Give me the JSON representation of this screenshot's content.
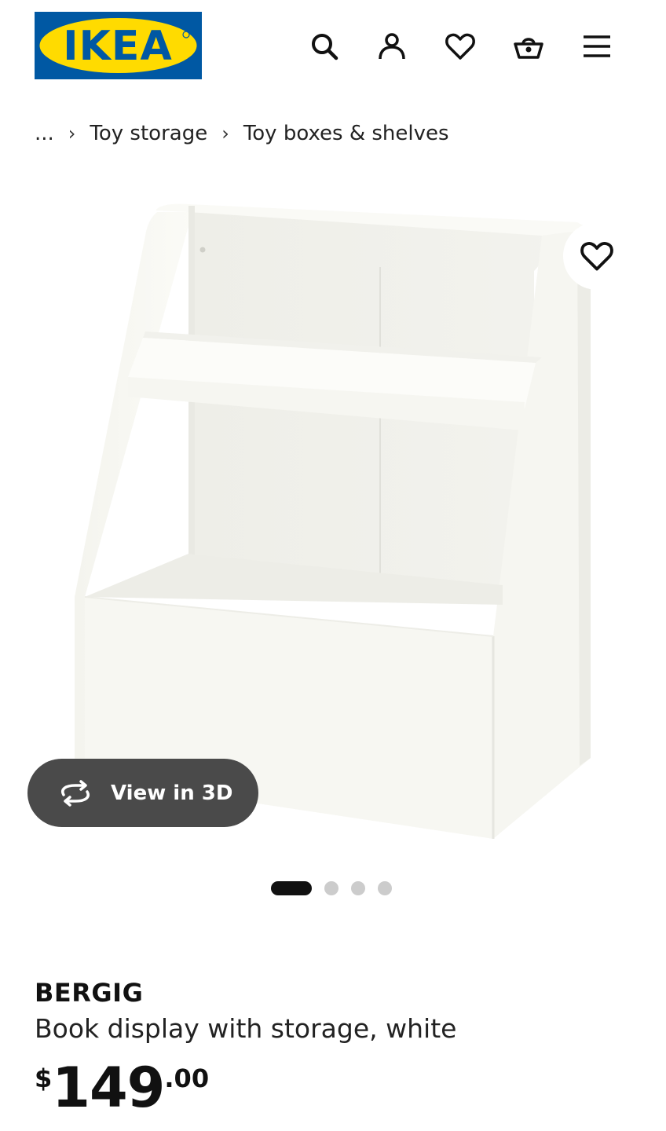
{
  "header": {
    "logo_text": "IKEA",
    "icons": [
      "search-icon",
      "account-icon",
      "favourites-icon",
      "basket-icon",
      "menu-icon"
    ]
  },
  "breadcrumb": {
    "ellipsis": "...",
    "separator": "›",
    "items": [
      "Toy storage",
      "Toy boxes & shelves"
    ]
  },
  "media": {
    "view_3d_label": "View in 3D",
    "slide_count": 4,
    "active_slide": 1
  },
  "product": {
    "name": "BERGIG",
    "description": "Book display with storage, white",
    "price": {
      "currency": "$",
      "integer": "149",
      "decimal": ".00"
    }
  },
  "colors": {
    "brand_blue": "#0058a3",
    "brand_yellow": "#ffdb00",
    "view3d_bg": "#4a4a4a",
    "text": "#111111"
  }
}
